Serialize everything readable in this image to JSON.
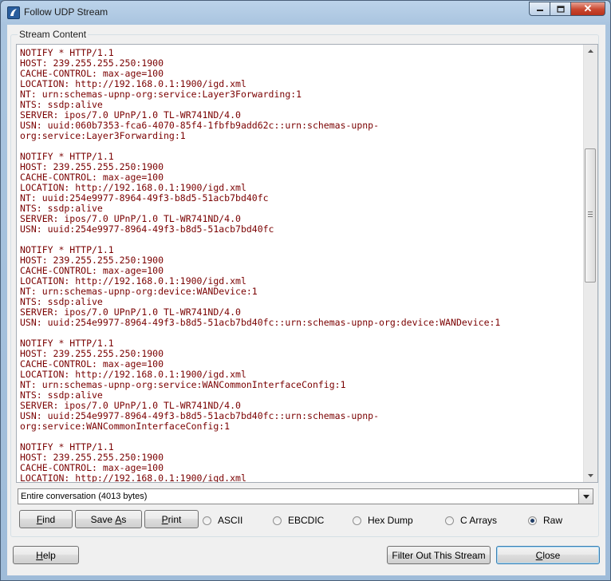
{
  "window": {
    "title": "Follow UDP Stream",
    "icon": "wireshark-fin-icon"
  },
  "window_controls": {
    "minimize_icon": "minimize-icon",
    "maximize_icon": "maximize-icon",
    "close_glyph": "✕"
  },
  "stream": {
    "group_label": "Stream Content",
    "lines": [
      "NOTIFY * HTTP/1.1",
      "HOST: 239.255.255.250:1900",
      "CACHE-CONTROL: max-age=100",
      "LOCATION: http://192.168.0.1:1900/igd.xml",
      "NT: urn:schemas-upnp-org:service:Layer3Forwarding:1",
      "NTS: ssdp:alive",
      "SERVER: ipos/7.0 UPnP/1.0 TL-WR741ND/4.0",
      "USN: uuid:060b7353-fca6-4070-85f4-1fbfb9add62c::urn:schemas-upnp-",
      "org:service:Layer3Forwarding:1",
      "",
      "NOTIFY * HTTP/1.1",
      "HOST: 239.255.255.250:1900",
      "CACHE-CONTROL: max-age=100",
      "LOCATION: http://192.168.0.1:1900/igd.xml",
      "NT: uuid:254e9977-8964-49f3-b8d5-51acb7bd40fc",
      "NTS: ssdp:alive",
      "SERVER: ipos/7.0 UPnP/1.0 TL-WR741ND/4.0",
      "USN: uuid:254e9977-8964-49f3-b8d5-51acb7bd40fc",
      "",
      "NOTIFY * HTTP/1.1",
      "HOST: 239.255.255.250:1900",
      "CACHE-CONTROL: max-age=100",
      "LOCATION: http://192.168.0.1:1900/igd.xml",
      "NT: urn:schemas-upnp-org:device:WANDevice:1",
      "NTS: ssdp:alive",
      "SERVER: ipos/7.0 UPnP/1.0 TL-WR741ND/4.0",
      "USN: uuid:254e9977-8964-49f3-b8d5-51acb7bd40fc::urn:schemas-upnp-org:device:WANDevice:1",
      "",
      "NOTIFY * HTTP/1.1",
      "HOST: 239.255.255.250:1900",
      "CACHE-CONTROL: max-age=100",
      "LOCATION: http://192.168.0.1:1900/igd.xml",
      "NT: urn:schemas-upnp-org:service:WANCommonInterfaceConfig:1",
      "NTS: ssdp:alive",
      "SERVER: ipos/7.0 UPnP/1.0 TL-WR741ND/4.0",
      "USN: uuid:254e9977-8964-49f3-b8d5-51acb7bd40fc::urn:schemas-upnp-",
      "org:service:WANCommonInterfaceConfig:1",
      "",
      "NOTIFY * HTTP/1.1",
      "HOST: 239.255.255.250:1900",
      "CACHE-CONTROL: max-age=100",
      "LOCATION: http://192.168.0.1:1900/igd.xml"
    ],
    "text_color": "#7a0000"
  },
  "conversation_select": {
    "value": "Entire conversation (4013 bytes)"
  },
  "actions": {
    "find": {
      "prefix": "",
      "mnemonic": "F",
      "rest": "ind"
    },
    "save_as": {
      "prefix": "Save ",
      "mnemonic": "A",
      "rest": "s"
    },
    "print": {
      "prefix": "",
      "mnemonic": "P",
      "rest": "rint"
    }
  },
  "formats": [
    {
      "label": "ASCII",
      "selected": false
    },
    {
      "label": "EBCDIC",
      "selected": false
    },
    {
      "label": "Hex Dump",
      "selected": false
    },
    {
      "label": "C Arrays",
      "selected": false
    },
    {
      "label": "Raw",
      "selected": true
    }
  ],
  "footer": {
    "help": {
      "prefix": "",
      "mnemonic": "H",
      "rest": "elp"
    },
    "filter_out": "Filter Out This Stream",
    "close": {
      "prefix": "",
      "mnemonic": "C",
      "rest": "lose"
    }
  }
}
